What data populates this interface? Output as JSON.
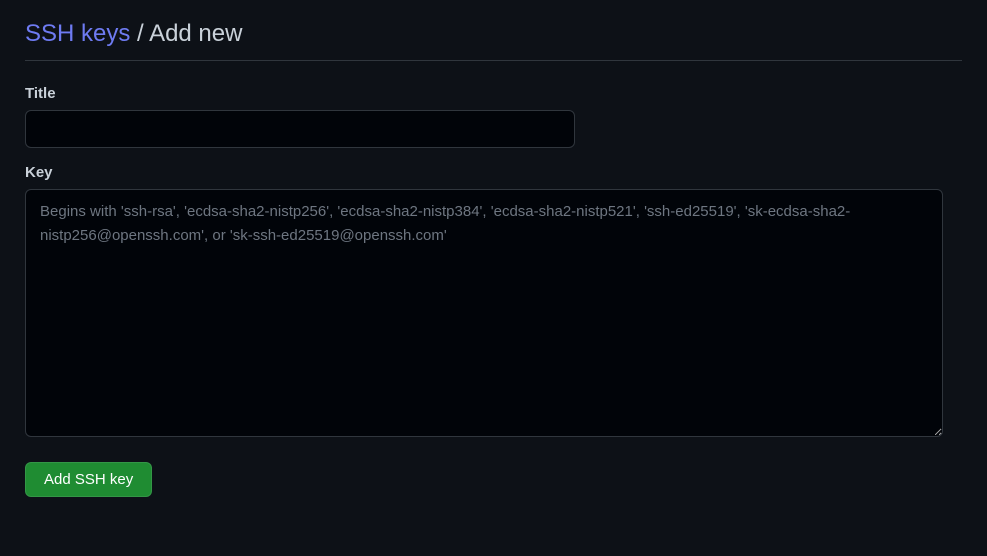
{
  "header": {
    "link_text": "SSH keys",
    "separator": " / ",
    "current": "Add new"
  },
  "form": {
    "title_label": "Title",
    "title_value": "",
    "key_label": "Key",
    "key_value": "",
    "key_placeholder": "Begins with 'ssh-rsa', 'ecdsa-sha2-nistp256', 'ecdsa-sha2-nistp384', 'ecdsa-sha2-nistp521', 'ssh-ed25519', 'sk-ecdsa-sha2-nistp256@openssh.com', or 'sk-ssh-ed25519@openssh.com'",
    "submit_label": "Add SSH key"
  }
}
